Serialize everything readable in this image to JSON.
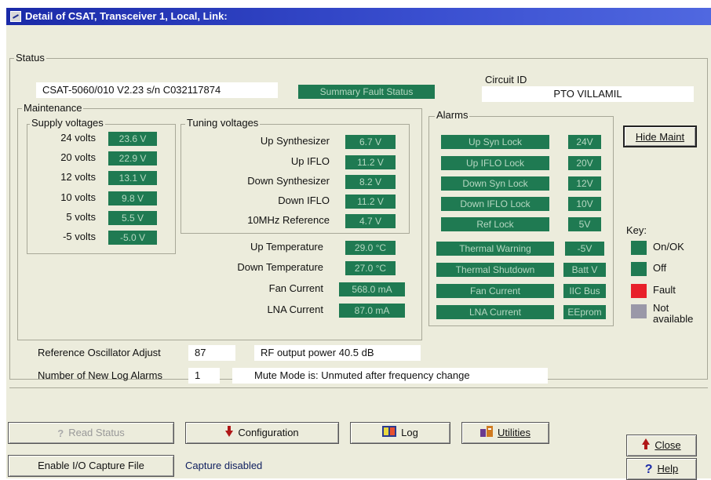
{
  "window": {
    "title": "Detail of CSAT, Transceiver 1, Local, Link:"
  },
  "status": {
    "group_label": "Status",
    "device_info": "CSAT-5060/010  V2.23  s/n C032117874",
    "summary_fault": "Summary Fault Status",
    "circuit_id_label": "Circuit ID",
    "circuit_id_value": "PTO VILLAMIL"
  },
  "maintenance": {
    "group_label": "Maintenance",
    "supply": {
      "group_label": "Supply voltages",
      "rows": [
        {
          "label": "24 volts",
          "value": "23.6 V"
        },
        {
          "label": "20 volts",
          "value": "22.9 V"
        },
        {
          "label": "12 volts",
          "value": "13.1 V"
        },
        {
          "label": "10 volts",
          "value": "9.8 V"
        },
        {
          "label": "5 volts",
          "value": "5.5 V"
        },
        {
          "label": "-5 volts",
          "value": "-5.0 V"
        }
      ]
    },
    "tuning": {
      "group_label": "Tuning voltages",
      "rows": [
        {
          "label": "Up Synthesizer",
          "value": "6.7 V"
        },
        {
          "label": "Up IFLO",
          "value": "11.2 V"
        },
        {
          "label": "Down Synthesizer",
          "value": "8.2 V"
        },
        {
          "label": "Down IFLO",
          "value": "11.2 V"
        },
        {
          "label": "10MHz Reference",
          "value": "4.7 V"
        }
      ]
    },
    "other": [
      {
        "label": "Up Temperature",
        "value": "29.0 °C"
      },
      {
        "label": "Down Temperature",
        "value": "27.0 °C"
      },
      {
        "label": "Fan Current",
        "value": "568.0 mA"
      },
      {
        "label": "LNA Current",
        "value": "87.0 mA"
      }
    ]
  },
  "alarms": {
    "group_label": "Alarms",
    "rows": [
      {
        "left": "Up Syn Lock",
        "right": "24V"
      },
      {
        "left": "Up IFLO Lock",
        "right": "20V"
      },
      {
        "left": "Down Syn Lock",
        "right": "12V"
      },
      {
        "left": "Down IFLO Lock",
        "right": "10V"
      },
      {
        "left": "Ref Lock",
        "right": "5V"
      },
      {
        "left": "Thermal Warning",
        "right": "-5V"
      },
      {
        "left": "Thermal Shutdown",
        "right": "Batt V"
      },
      {
        "left": "Fan Current",
        "right": "IIC Bus"
      },
      {
        "left": "LNA Current",
        "right": "EEprom"
      }
    ]
  },
  "key": {
    "title": "Key:",
    "items": [
      {
        "label": "On/OK",
        "color": "#1f7a52"
      },
      {
        "label": "Off",
        "color": "#1f7a52"
      },
      {
        "label": "Fault",
        "color": "#e8202a"
      },
      {
        "label": "Not available",
        "color": "#9a98a8"
      }
    ]
  },
  "bottom": {
    "ref_osc_label": "Reference Oscillator Adjust",
    "ref_osc_value": "87",
    "rf_output": "RF output power  40.5 dB",
    "log_alarms_label": "Number of New Log Alarms",
    "log_alarms_value": "1",
    "mute_mode": "Mute Mode is: Unmuted after frequency change"
  },
  "buttons": {
    "hide_maint": "Hide Maint",
    "read_status": "Read Status",
    "configuration": "Configuration",
    "log": "Log",
    "utilities": "Utilities",
    "close": "Close",
    "enable_capture": "Enable I/O Capture File",
    "help": "Help"
  },
  "capture_status": "Capture disabled",
  "colors": {
    "ok_green": "#1f7a52",
    "fault_red": "#e8202a",
    "not_available": "#9a98a8",
    "title_blue": "#1a2aa8"
  }
}
